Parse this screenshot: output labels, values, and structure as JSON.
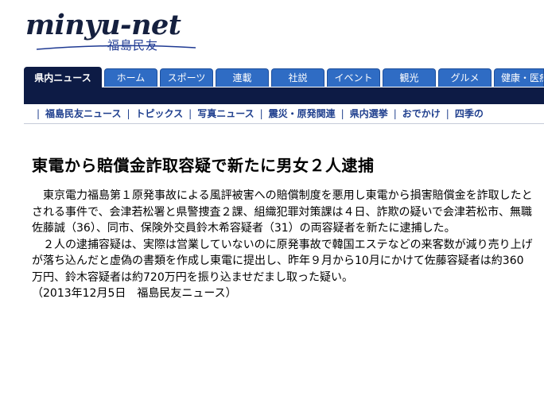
{
  "logo": {
    "main": "minyu-net",
    "sub": "福島民友"
  },
  "tabs": [
    {
      "label": "県内ニュース",
      "active": true
    },
    {
      "label": "ホーム",
      "active": false
    },
    {
      "label": "スポーツ",
      "active": false
    },
    {
      "label": "連載",
      "active": false
    },
    {
      "label": "社説",
      "active": false
    },
    {
      "label": "イベント",
      "active": false
    },
    {
      "label": "観光",
      "active": false
    },
    {
      "label": "グルメ",
      "active": false
    },
    {
      "label": "健康・医療",
      "active": false
    }
  ],
  "subnav": [
    "福島民友ニュース",
    "トピックス",
    "写真ニュース",
    "震災・原発関連",
    "県内選挙",
    "おでかけ",
    "四季の"
  ],
  "article": {
    "headline": "東電から賠償金詐取容疑で新たに男女２人逮捕",
    "paragraphs": [
      "　東京電力福島第１原発事故による風評被害への賠償制度を悪用し東電から損害賠償金を詐取したとされる事件で、会津若松署と県警捜査２課、組織犯罪対策課は４日、詐欺の疑いで会津若松市、無職佐藤誠（36）、同市、保険外交員鈴木希容疑者（31）の両容疑者を新たに逮捕した。",
      "　２人の逮捕容疑は、実際は営業していないのに原発事故で韓国エステなどの来客数が減り売り上げが落ち込んだと虚偽の書類を作成し東電に提出し、昨年９月から10月にかけて佐藤容疑者は約360万円、鈴木容疑者は約720万円を振り込ませだまし取った疑い。"
    ],
    "dateline": "（2013年12月5日　福島民友ニュース）"
  },
  "colors": {
    "tab_blue": "#2f6cc4",
    "nav_dark": "#0d1b45",
    "link_blue": "#1f3f8e"
  }
}
